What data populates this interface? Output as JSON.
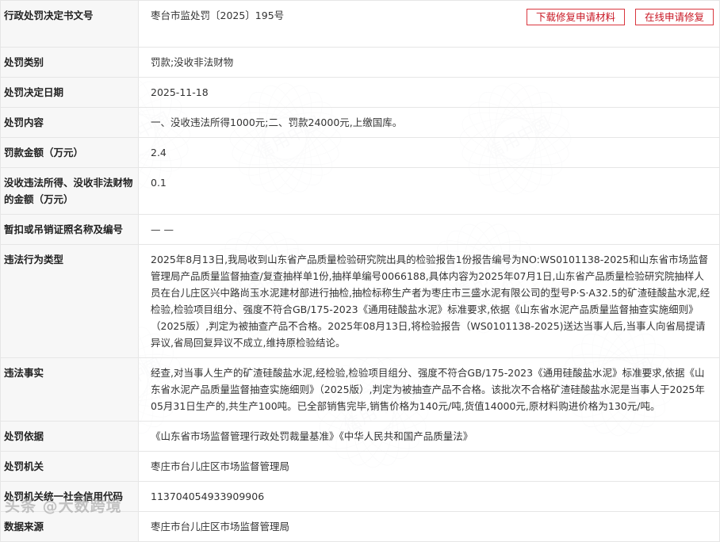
{
  "watermark": {
    "text": "信用中国"
  },
  "buttons": {
    "download": "下载修复申请材料",
    "apply": "在线申请修复"
  },
  "rows": [
    {
      "label": "行政处罚决定书文号",
      "value": "枣台市监处罚〔2025〕195号"
    },
    {
      "label": "处罚类别",
      "value": "罚款;没收非法财物"
    },
    {
      "label": "处罚决定日期",
      "value": "2025-11-18"
    },
    {
      "label": "处罚内容",
      "value": "一、没收违法所得1000元;二、罚款24000元,上缴国库。"
    },
    {
      "label": "罚款金额（万元）",
      "value": "2.4"
    },
    {
      "label": "没收违法所得、没收非法财物的金额（万元）",
      "value": "0.1"
    },
    {
      "label": "暂扣或吊销证照名称及编号",
      "value": "— —"
    },
    {
      "label": "违法行为类型",
      "value": "2025年8月13日,我局收到山东省产品质量检验研究院出具的检验报告1份报告编号为NO:WS0101138-2025和山东省市场监督管理局产品质量监督抽查/复查抽样单1份,抽样单编号0066188,具体内容为2025年07月1日,山东省产品质量检验研究院抽样人员在台儿庄区兴中路尚玉水泥建材部进行抽检,抽检标称生产者为枣庄市三盛水泥有限公司的型号P·S·A32.5的矿渣硅酸盐水泥,经检验,检验项目组分、强度不符合GB/175-2023《通用硅酸盐水泥》标准要求,依据《山东省水泥产品质量监督抽查实施细则》（2025版）,判定为被抽查产品不合格。2025年08月13日,将检验报告（WS0101138-2025)送达当事人后,当事人向省局提请异议,省局回复异议不成立,维持原检验结论。"
    },
    {
      "label": "违法事实",
      "value": "经查,对当事人生产的矿渣硅酸盐水泥,经检验,检验项目组分、强度不符合GB/175-2023《通用硅酸盐水泥》标准要求,依据《山东省水泥产品质量监督抽查实施细则》（2025版）,判定为被抽查产品不合格。该批次不合格矿渣硅酸盐水泥是当事人于2025年05月31日生产的,共生产100吨。已全部销售完毕,销售价格为140元/吨,货值14000元,原材料购进价格为130元/吨。"
    },
    {
      "label": "处罚依据",
      "value": "《山东省市场监督管理行政处罚裁量基准》《中华人民共和国产品质量法》"
    },
    {
      "label": "处罚机关",
      "value": "枣庄市台儿庄区市场监督管理局"
    },
    {
      "label": "处罚机关统一社会信用代码",
      "value": "113704054933909906"
    },
    {
      "label": "数据来源",
      "value": "枣庄市台儿庄区市场监督管理局"
    }
  ],
  "footer_watermark": "头条 @大数跨境"
}
